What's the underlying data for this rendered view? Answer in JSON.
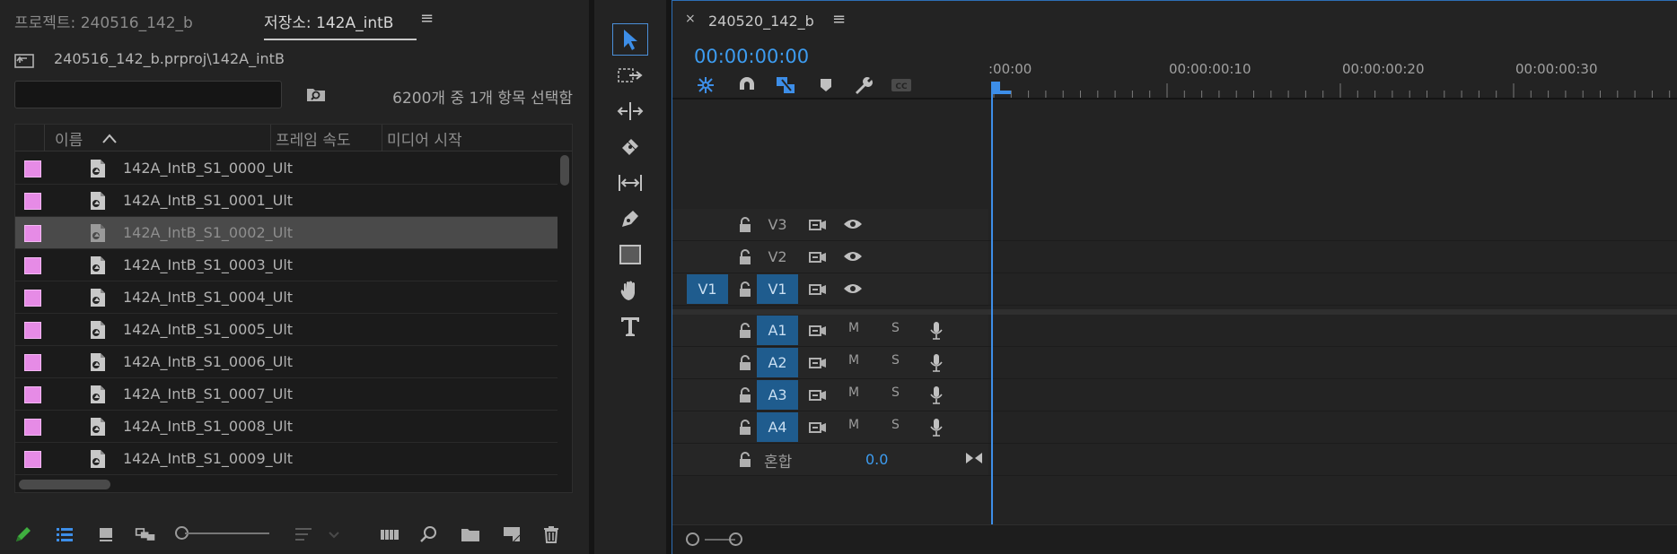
{
  "project": {
    "tab_project": "프로젝트: 240516_142_b",
    "tab_bin": "저장소: 142A_intB",
    "tab_menu": "≡",
    "path": "240516_142_b.prproj\\142A_intB",
    "search_value": "",
    "selection_status": "6200개 중 1개 항목 선택함",
    "columns": [
      "이름",
      "프레임 속도",
      "미디어 시작"
    ],
    "items": [
      {
        "name": "142A_IntB_S1_0000_Ult",
        "label_color": "#e68be6"
      },
      {
        "name": "142A_IntB_S1_0001_Ult",
        "label_color": "#e68be6"
      },
      {
        "name": "142A_IntB_S1_0002_Ult",
        "label_color": "#e68be6",
        "selected": true
      },
      {
        "name": "142A_IntB_S1_0003_Ult",
        "label_color": "#e68be6"
      },
      {
        "name": "142A_IntB_S1_0004_Ult",
        "label_color": "#e68be6"
      },
      {
        "name": "142A_IntB_S1_0005_Ult",
        "label_color": "#e68be6"
      },
      {
        "name": "142A_IntB_S1_0006_Ult",
        "label_color": "#e68be6"
      },
      {
        "name": "142A_IntB_S1_0007_Ult",
        "label_color": "#e68be6"
      },
      {
        "name": "142A_IntB_S1_0008_Ult",
        "label_color": "#e68be6"
      },
      {
        "name": "142A_IntB_S1_0009_Ult",
        "label_color": "#e68be6"
      }
    ],
    "bottom_tools": [
      "pencil-icon",
      "list-view-icon",
      "icon-view-icon",
      "freeform-view-icon",
      "zoom-slider",
      "sort-icon",
      "automate-icon",
      "find-icon",
      "new-bin-icon",
      "new-item-icon",
      "trash-icon"
    ]
  },
  "tools": [
    "selection-tool-icon",
    "track-select-tool-icon",
    "ripple-edit-tool-icon",
    "razor-tool-icon",
    "slip-tool-icon",
    "pen-tool-icon",
    "rectangle-tool-icon",
    "hand-tool-icon",
    "type-tool-icon"
  ],
  "timeline": {
    "close": "×",
    "title": "240520_142_b",
    "menu": "≡",
    "timecode": "00:00:00:00",
    "ruler_labels": [
      ":00:00",
      "00:00:00:10",
      "00:00:00:20",
      "00:00:00:30"
    ],
    "video_tracks": [
      {
        "name": "V3",
        "targeted": false,
        "source": ""
      },
      {
        "name": "V2",
        "targeted": false,
        "source": ""
      },
      {
        "name": "V1",
        "targeted": true,
        "source": "V1"
      }
    ],
    "audio_tracks": [
      {
        "name": "A1",
        "mute": "M",
        "solo": "S"
      },
      {
        "name": "A2",
        "mute": "M",
        "solo": "S"
      },
      {
        "name": "A3",
        "mute": "M",
        "solo": "S"
      },
      {
        "name": "A4",
        "mute": "M",
        "solo": "S"
      }
    ],
    "mix_label": "혼합",
    "mix_value": "0.0",
    "accent_color": "#3d9cf0",
    "target_color": "#1f5c8e"
  }
}
